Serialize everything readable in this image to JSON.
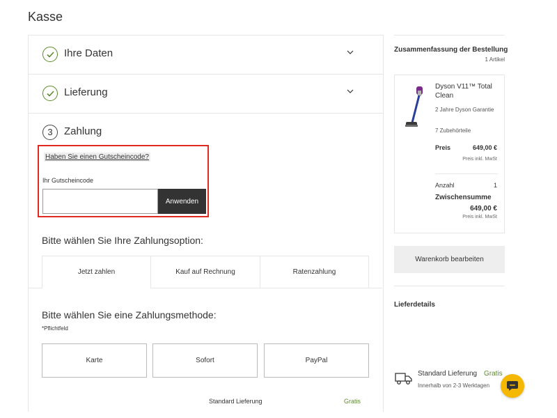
{
  "page": {
    "title": "Kasse"
  },
  "sections": {
    "personal": {
      "label": "Ihre Daten"
    },
    "delivery": {
      "label": "Lieferung"
    },
    "payment": {
      "number": "3",
      "label": "Zahlung"
    }
  },
  "coupon": {
    "link": "Haben Sie einen Gutscheincode?",
    "label": "Ihr Gutscheincode",
    "value": "",
    "placeholder": "",
    "button": "Anwenden"
  },
  "payment_options": {
    "title": "Bitte wählen Sie Ihre Zahlungsoption:",
    "tabs": [
      "Jetzt zahlen",
      "Kauf auf Rechnung",
      "Ratenzahlung"
    ],
    "active_tab": "Jetzt zahlen"
  },
  "payment_methods": {
    "title": "Bitte wählen Sie eine Zahlungsmethode:",
    "required_note": "*Pflichtfeld",
    "methods": [
      "Karte",
      "Sofort",
      "PayPal"
    ]
  },
  "shipping_row": {
    "label": "Standard Lieferung",
    "price": "Gratis"
  },
  "summary": {
    "title": "Zusammenfassung der Bestellung",
    "count": "1 Artikel",
    "product": {
      "name": "Dyson V11™ Total Clean",
      "warranty": "2 Jahre Dyson Garantie",
      "accessories": "7 Zubehörteile",
      "price_label": "Preis",
      "price": "649,00 €",
      "vat_note": "Preis inkl. MwSt",
      "qty_label": "Anzahl",
      "qty": "1",
      "subtotal_label": "Zwischensumme",
      "subtotal": "649,00 €",
      "subtotal_vat_note": "Preis inkl. MwSt"
    },
    "edit_cart": "Warenkorb bearbeiten",
    "delivery_title": "Lieferdetails",
    "delivery_option": {
      "name": "Standard Lieferung",
      "price": "Gratis",
      "time": "Innerhalb von 2-3 Werktagen"
    }
  },
  "colors": {
    "accent_green": "#5c8a2e",
    "highlight_red": "#e02a1f",
    "chat_yellow": "#f5b800",
    "dark_button": "#333333"
  },
  "icons": [
    "check-circle-icon",
    "chevron-down-icon",
    "vacuum-product-image",
    "delivery-truck-icon",
    "chat-icon"
  ]
}
